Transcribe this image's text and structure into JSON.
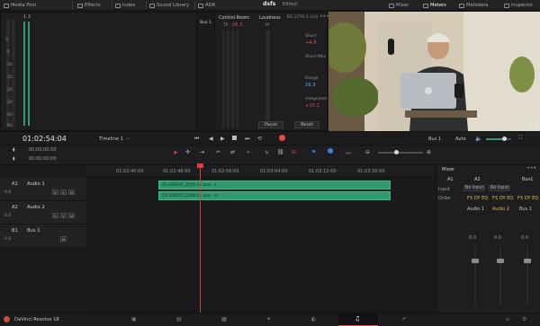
{
  "topbar": {
    "items": [
      "Media Pool",
      "Effects",
      "Index",
      "Sound Library",
      "ADR"
    ],
    "project_title": "dsfs",
    "project_status": "Edited",
    "right_items": [
      "Mixer",
      "Meters",
      "Metadata",
      "Inspector"
    ]
  },
  "meters_panel": {
    "bus_label": "Bus 1",
    "control_room_title": "Control Room",
    "tp_label": "TP",
    "tp_value": "-16.3",
    "m_label": "M",
    "loudness_title": "Loudness",
    "loudness_standard": "BS.1770-1 (LU)",
    "short_label": "Short",
    "short_value": "+4.8",
    "short_max_label": "Short Max",
    "range_label": "Range",
    "range_value": "16.3",
    "integrated_label": "Integrated",
    "integrated_value": "+10.1",
    "pause_label": "Pause",
    "reset_label": "Reset",
    "left_scale": [
      "0",
      "-5",
      "-10",
      "-15",
      "-20",
      "-30",
      "-40",
      "-50"
    ],
    "meter_labels": [
      "1",
      "2"
    ]
  },
  "timecode": {
    "current": "01:02:54:04",
    "timeline_name": "Timeline 1",
    "bus_output": "Bus 1",
    "mode": "Auto",
    "zero1": "00:00:00:00",
    "zero2": "00:00:00:00"
  },
  "ruler": {
    "ticks": [
      "01:02:40:00",
      "01:02:48:00",
      "01:02:56:00",
      "01:03:04:00",
      "01:03:12:00",
      "01:03:20:00"
    ]
  },
  "tracks": [
    {
      "id": "A1",
      "name": "Audio 1",
      "value": "0.0"
    },
    {
      "id": "A2",
      "name": "Audio 2",
      "value": "0.0"
    },
    {
      "id": "B1",
      "name": "Bus 1",
      "value": "0.0"
    }
  ],
  "clips": [
    {
      "label": "01-290207_2240.01 wav - L"
    },
    {
      "label": "01-290207_2240.01 wav - R"
    }
  ],
  "mixer": {
    "title": "Mixer",
    "cols": [
      "A1",
      "A2",
      "Bus1"
    ],
    "input_label": "Input",
    "input_values": [
      "No Input",
      "No Input"
    ],
    "order_label": "Order",
    "order_values": [
      "FX DY EQ",
      "FX DY EQ",
      "FX DY EQ"
    ],
    "track_names": [
      "Audio 1",
      "Audio 2",
      "Bus 1"
    ],
    "colors": {
      "audio1": "#c8c8cc",
      "audio2": "#e0b24a",
      "bus1": "#c8c8cc"
    },
    "gain": [
      "0.0",
      "0.0",
      "0.0"
    ]
  },
  "bottombar": {
    "app_name": "DaVinci Resolve 18"
  },
  "colors": {
    "accent_red": "#e24b4b",
    "accent_blue": "#3b7fe0",
    "clip_green": "#2f9a6d",
    "playhead": "#e03a3a"
  }
}
